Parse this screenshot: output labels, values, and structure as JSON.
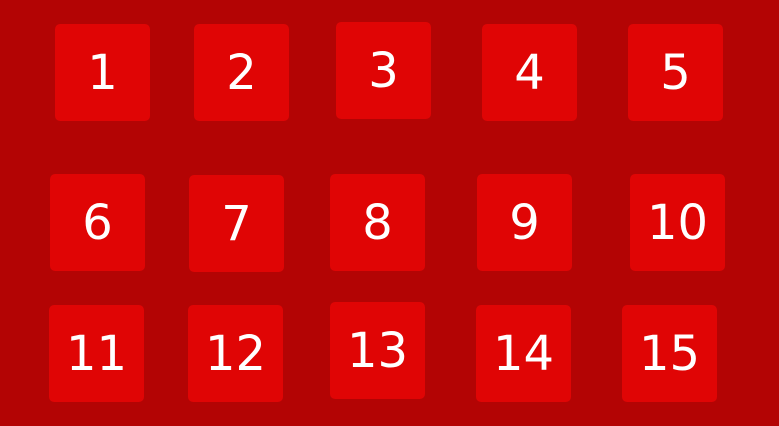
{
  "colors": {
    "background": "#b30404",
    "tile": "#e00505",
    "text": "#ffffff"
  },
  "tiles": [
    {
      "label": "1"
    },
    {
      "label": "2"
    },
    {
      "label": "3"
    },
    {
      "label": "4"
    },
    {
      "label": "5"
    },
    {
      "label": "6"
    },
    {
      "label": "7"
    },
    {
      "label": "8"
    },
    {
      "label": "9"
    },
    {
      "label": "10"
    },
    {
      "label": "11"
    },
    {
      "label": "12"
    },
    {
      "label": "13"
    },
    {
      "label": "14"
    },
    {
      "label": "15"
    }
  ]
}
